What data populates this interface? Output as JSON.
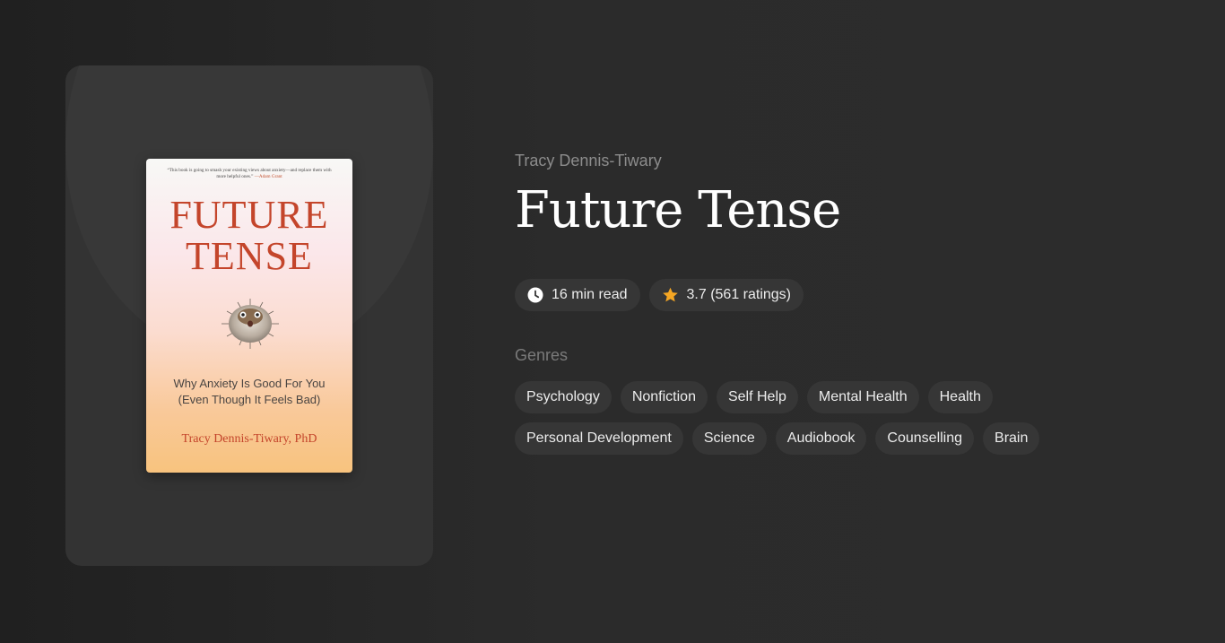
{
  "book": {
    "author": "Tracy Dennis-Tiwary",
    "title": "Future Tense"
  },
  "cover": {
    "quote": "“This book is going to smash your existing views about anxiety—and replace them with more helpful ones.”",
    "quote_author": "—Adam Grant",
    "title_line1": "FUTURE",
    "title_line2": "TENSE",
    "subtitle_line1": "Why Anxiety Is Good For You",
    "subtitle_line2": "(Even Though It Feels Bad)",
    "author": "Tracy Dennis-Tiwary, PhD"
  },
  "meta": {
    "read_time": "16 min read",
    "rating": "3.7 (561 ratings)"
  },
  "genres_label": "Genres",
  "genres": [
    "Psychology",
    "Nonfiction",
    "Self Help",
    "Mental Health",
    "Health",
    "Personal Development",
    "Science",
    "Audiobook",
    "Counselling",
    "Brain"
  ],
  "colors": {
    "background": "#2b2b2b",
    "panel": "#333333",
    "pill": "#363636",
    "star": "#f5a623",
    "cover_red": "#c4452b"
  },
  "icons": {
    "read_time": "clock-icon",
    "rating": "star-icon"
  }
}
